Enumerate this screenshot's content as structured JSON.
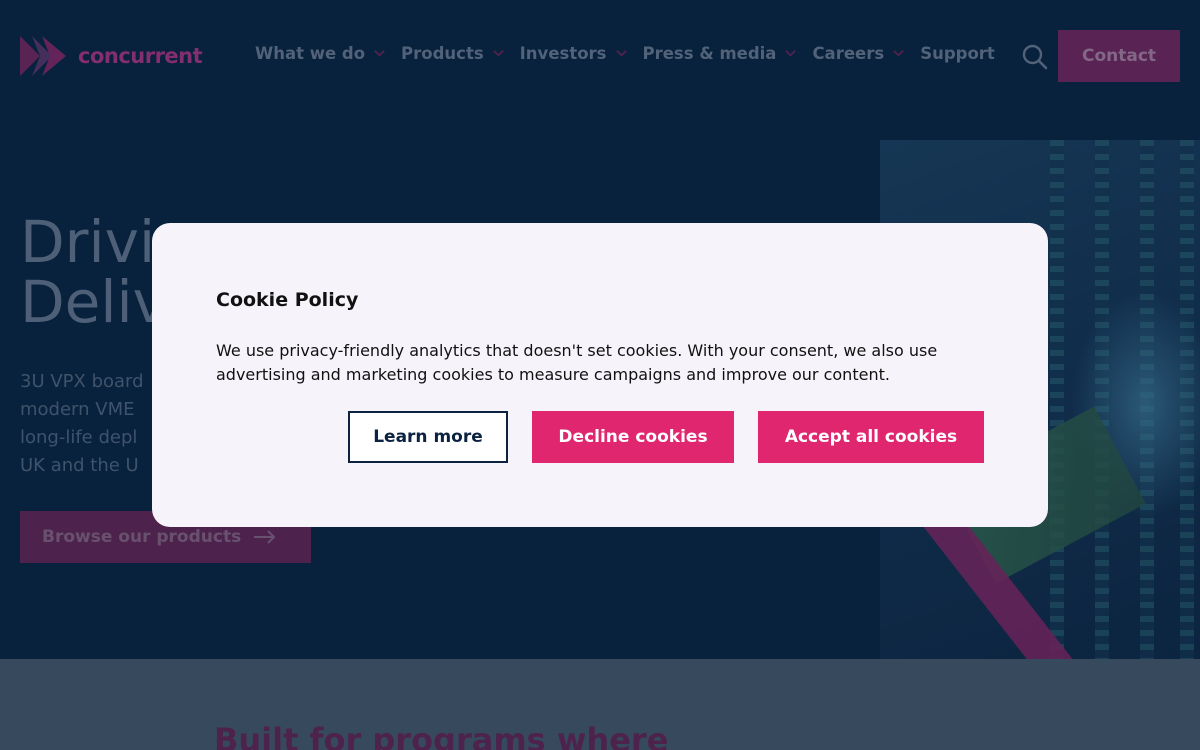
{
  "brand": {
    "name": "concurrent",
    "accent": "#e0266f",
    "navy": "#0b2240"
  },
  "nav": {
    "items": [
      {
        "label": "What we do",
        "has_dropdown": true
      },
      {
        "label": "Products",
        "has_dropdown": true
      },
      {
        "label": "Investors",
        "has_dropdown": true
      },
      {
        "label": "Press & media",
        "has_dropdown": true
      },
      {
        "label": "Careers",
        "has_dropdown": true
      },
      {
        "label": "Support",
        "has_dropdown": false
      }
    ],
    "search_icon": "search-icon",
    "contact_label": "Contact"
  },
  "hero": {
    "title_lines": [
      "Drivi",
      "Deliv"
    ],
    "description_lines": [
      "3U VPX board",
      "modern VME",
      "long-life depl",
      "UK and the U"
    ],
    "cta_label": "Browse our products"
  },
  "section": {
    "title": "Built for programs where"
  },
  "cookie_modal": {
    "title": "Cookie Policy",
    "text": "We use privacy-friendly analytics that doesn't set cookies. With your consent, we also use advertising and marketing cookies to measure campaigns and improve our content.",
    "buttons": {
      "learn_more": "Learn more",
      "decline": "Decline cookies",
      "accept": "Accept all cookies"
    }
  }
}
